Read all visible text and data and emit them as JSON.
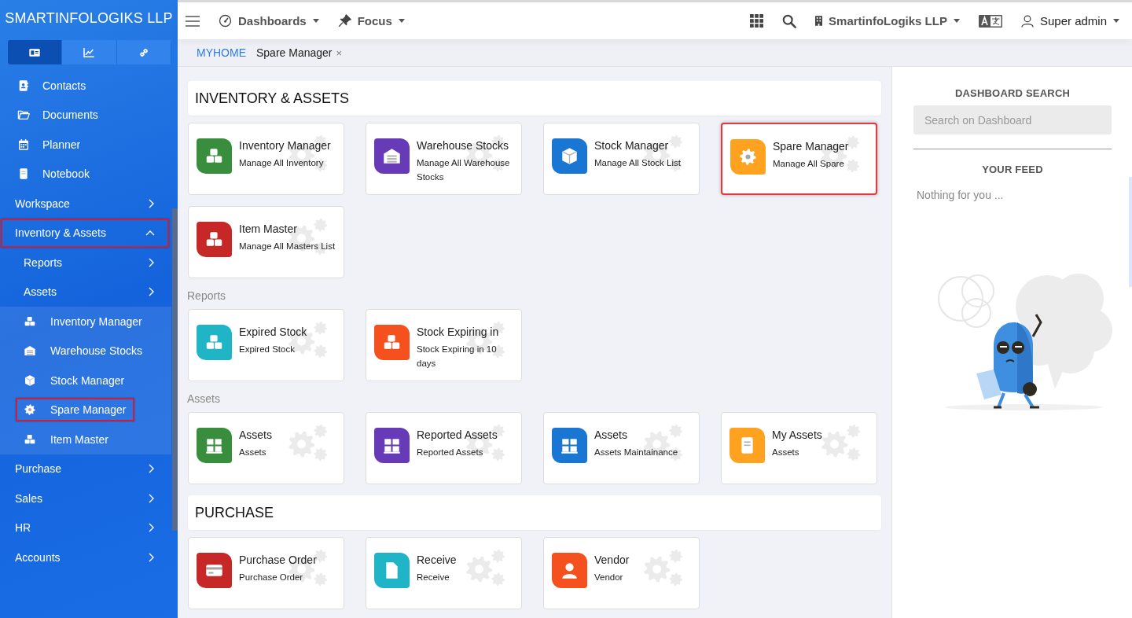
{
  "sidebar": {
    "brand": "SMARTINFOLOGIKS LLP",
    "tabs": [
      {
        "selected": true
      },
      {
        "selected": false
      },
      {
        "selected": false
      }
    ],
    "items": [
      {
        "kind": "link",
        "label": "Contacts",
        "highlighted": false
      },
      {
        "kind": "link",
        "label": "Documents",
        "highlighted": false
      },
      {
        "kind": "link",
        "label": "Planner",
        "highlighted": false
      },
      {
        "kind": "link",
        "label": "Notebook",
        "highlighted": false
      },
      {
        "kind": "group",
        "label": "Workspace",
        "expanded": false,
        "highlighted": false
      },
      {
        "kind": "group",
        "label": "Inventory & Assets",
        "expanded": true,
        "highlighted": true,
        "children": [
          {
            "kind": "group",
            "label": "Reports",
            "expanded": false,
            "highlighted": false
          },
          {
            "kind": "group",
            "label": "Assets",
            "expanded": false,
            "highlighted": false
          },
          {
            "kind": "link",
            "label": "Inventory Manager",
            "highlighted": false
          },
          {
            "kind": "link",
            "label": "Warehouse Stocks",
            "highlighted": false
          },
          {
            "kind": "link",
            "label": "Stock Manager",
            "highlighted": false
          },
          {
            "kind": "link",
            "label": "Spare Manager",
            "highlighted": true
          },
          {
            "kind": "link",
            "label": "Item Master",
            "highlighted": false
          }
        ]
      },
      {
        "kind": "group",
        "label": "Purchase",
        "expanded": false,
        "highlighted": false
      },
      {
        "kind": "group",
        "label": "Sales",
        "expanded": false,
        "highlighted": false
      },
      {
        "kind": "group",
        "label": "HR",
        "expanded": false,
        "highlighted": false
      },
      {
        "kind": "group",
        "label": "Accounts",
        "expanded": false,
        "highlighted": false
      }
    ]
  },
  "topbar": {
    "menus": [
      {
        "label": "Dashboards"
      },
      {
        "label": "Focus"
      }
    ],
    "company": "SmartinfoLogiks LLP",
    "user": "Super admin"
  },
  "breadcrumb": {
    "home": "MYHOME",
    "tab": {
      "label": "Spare Manager",
      "close": "×"
    }
  },
  "sections": [
    {
      "title": "INVENTORY & ASSETS",
      "groups": [
        {
          "cards": [
            {
              "title": "Inventory Manager",
              "subtitle": "Manage All Inventory",
              "color": "#388e3c",
              "highlighted": false
            },
            {
              "title": "Warehouse Stocks",
              "subtitle": "Manage All Warehouse Stocks",
              "color": "#673ab7",
              "highlighted": false
            },
            {
              "title": "Stock Manager",
              "subtitle": "Manage All Stock List",
              "color": "#1976d2",
              "highlighted": false
            },
            {
              "title": "Spare Manager",
              "subtitle": "Manage All Spare",
              "color": "#ffa21f",
              "highlighted": true
            },
            {
              "title": "Item Master",
              "subtitle": "Manage All Masters List",
              "color": "#c62828",
              "highlighted": false
            }
          ]
        },
        {
          "label": "Reports",
          "cards": [
            {
              "title": "Expired Stock",
              "subtitle": "Expired Stock",
              "color": "#1fb5c6",
              "highlighted": false
            },
            {
              "title": "Stock Expiring in",
              "subtitle": "Stock Expiring in 10 days",
              "color": "#f4511e",
              "highlighted": false
            }
          ]
        },
        {
          "label": "Assets",
          "cards": [
            {
              "title": "Assets",
              "subtitle": "Assets",
              "color": "#388e3c",
              "highlighted": false
            },
            {
              "title": "Reported Assets",
              "subtitle": "Reported Assets",
              "color": "#673ab7",
              "highlighted": false
            },
            {
              "title": "Assets",
              "subtitle": "Assets Maintainance",
              "color": "#1976d2",
              "highlighted": false
            },
            {
              "title": "My Assets",
              "subtitle": "Assets",
              "color": "#ffa21f",
              "highlighted": false
            }
          ]
        }
      ]
    },
    {
      "title": "PURCHASE",
      "groups": [
        {
          "cards": [
            {
              "title": "Purchase Order",
              "subtitle": "Purchase Order",
              "color": "#c62828",
              "highlighted": false
            },
            {
              "title": "Receive",
              "subtitle": "Receive",
              "color": "#1fb5c6",
              "highlighted": false
            },
            {
              "title": "Vendor",
              "subtitle": "Vendor",
              "color": "#f4511e",
              "highlighted": false
            }
          ]
        }
      ]
    }
  ],
  "panel": {
    "search_title": "DASHBOARD SEARCH",
    "search": {
      "placeholder": "Search on Dashboard"
    },
    "feed_title": "YOUR FEED",
    "feed_empty": "Nothing for you ..."
  }
}
